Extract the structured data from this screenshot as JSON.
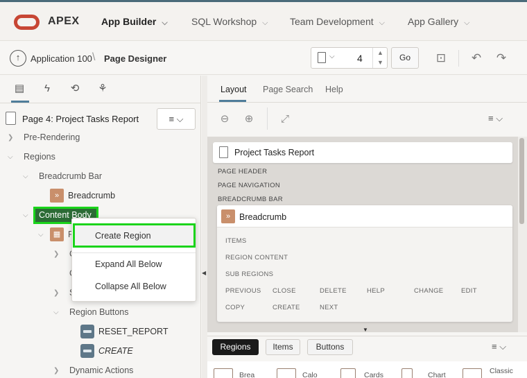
{
  "header": {
    "brand": "APEX",
    "nav": [
      {
        "label": "App Builder"
      },
      {
        "label": "SQL Workshop"
      },
      {
        "label": "Team Development"
      },
      {
        "label": "App Gallery"
      }
    ]
  },
  "toolbar": {
    "breadcrumb_app": "Application 100",
    "breadcrumb_page": "Page Designer",
    "page_number": "4",
    "go_label": "Go",
    "chevron": "⌵",
    "spin_up": "▲",
    "spin_down": "▼"
  },
  "left": {
    "page_title": "Page 4: Project Tasks Report",
    "menu_glyph": "≡ ⌵",
    "tree": {
      "pre_rendering": "Pre-Rendering",
      "regions": "Regions",
      "breadcrumb_bar": "Breadcrumb Bar",
      "breadcrumb": "Breadcrumb",
      "content_body": "Content Body",
      "truncated_p": "P",
      "truncated_c1": "C",
      "truncated_c2": "C",
      "truncated_s": "S",
      "region_buttons": "Region Buttons",
      "reset_report": "RESET_REPORT",
      "create": "CREATE",
      "dynamic_actions": "Dynamic Actions"
    },
    "context_menu": {
      "create_region": "Create Region",
      "expand_all_below": "Expand All Below",
      "collapse_all_below": "Collapse All Below"
    }
  },
  "right": {
    "tabs": [
      "Layout",
      "Page Search",
      "Help"
    ],
    "menu_glyph": "≡ ⌵",
    "layout": {
      "page_title": "Project Tasks Report",
      "page_header": "PAGE HEADER",
      "page_navigation": "PAGE NAVIGATION",
      "breadcrumb_bar": "BREADCRUMB BAR",
      "breadcrumb_region": "Breadcrumb",
      "slots": {
        "items": "ITEMS",
        "region_content": "REGION CONTENT",
        "sub_regions": "SUB REGIONS",
        "previous": "PREVIOUS",
        "close": "CLOSE",
        "delete": "DELETE",
        "help": "HELP",
        "change": "CHANGE",
        "edit": "EDIT",
        "copy": "COPY",
        "create": "CREATE",
        "next": "NEXT"
      }
    },
    "gallery": {
      "tabs": [
        "Regions",
        "Items",
        "Buttons"
      ],
      "menu_glyph": "≡ ⌵",
      "items": [
        "Brea",
        "Calo",
        "Cards",
        "Chart",
        "Classic"
      ]
    }
  }
}
